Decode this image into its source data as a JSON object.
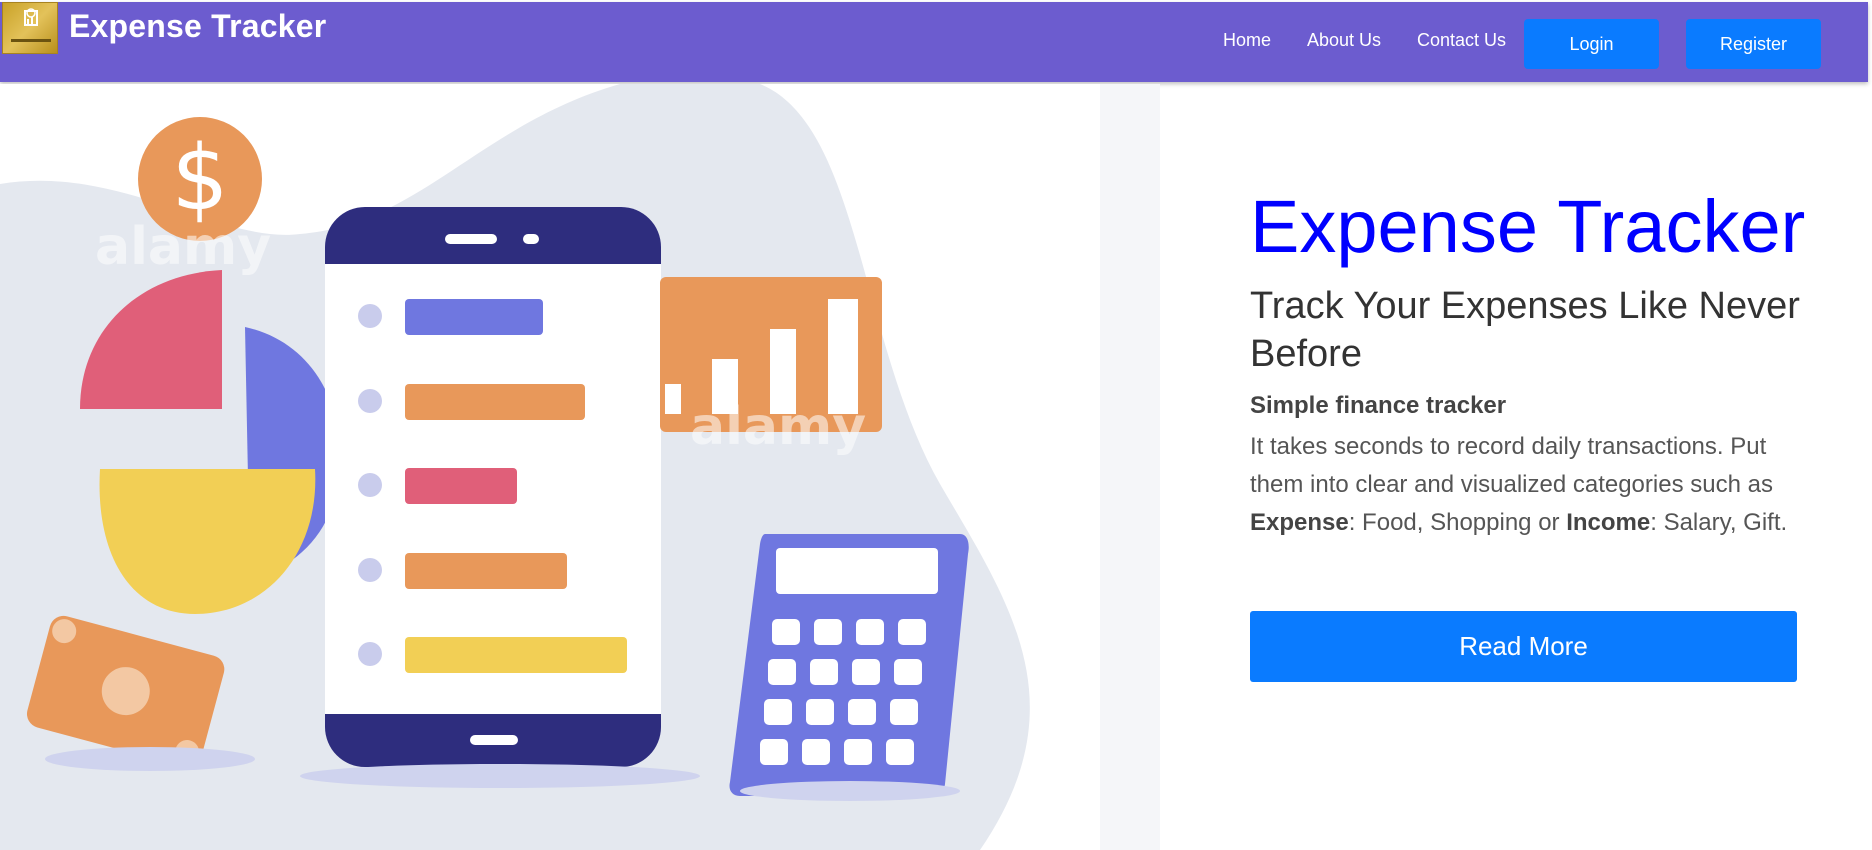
{
  "navbar": {
    "brand": "Expense Tracker",
    "logo_icon": "expense-tracker-logo",
    "links": [
      "Home",
      "About Us",
      "Contact Us"
    ],
    "login_label": "Login",
    "register_label": "Register",
    "background": "#6c5ccf",
    "button_color": "#0a7bff"
  },
  "hero": {
    "image_icon": "finance-illustration",
    "watermark": "alamy",
    "title": "Expense Tracker",
    "subtitle": "Track Your Expenses Like Never Before",
    "tagline": "Simple finance tracker",
    "desc_part1": "It takes seconds to record daily transactions. Put them into clear and visualized categories such as ",
    "desc_bold1": "Expense",
    "desc_part2": ": Food, Shopping or ",
    "desc_bold2": "Income",
    "desc_part3": ": Salary, Gift.",
    "read_more_label": "Read More",
    "title_color": "#0000ff"
  }
}
